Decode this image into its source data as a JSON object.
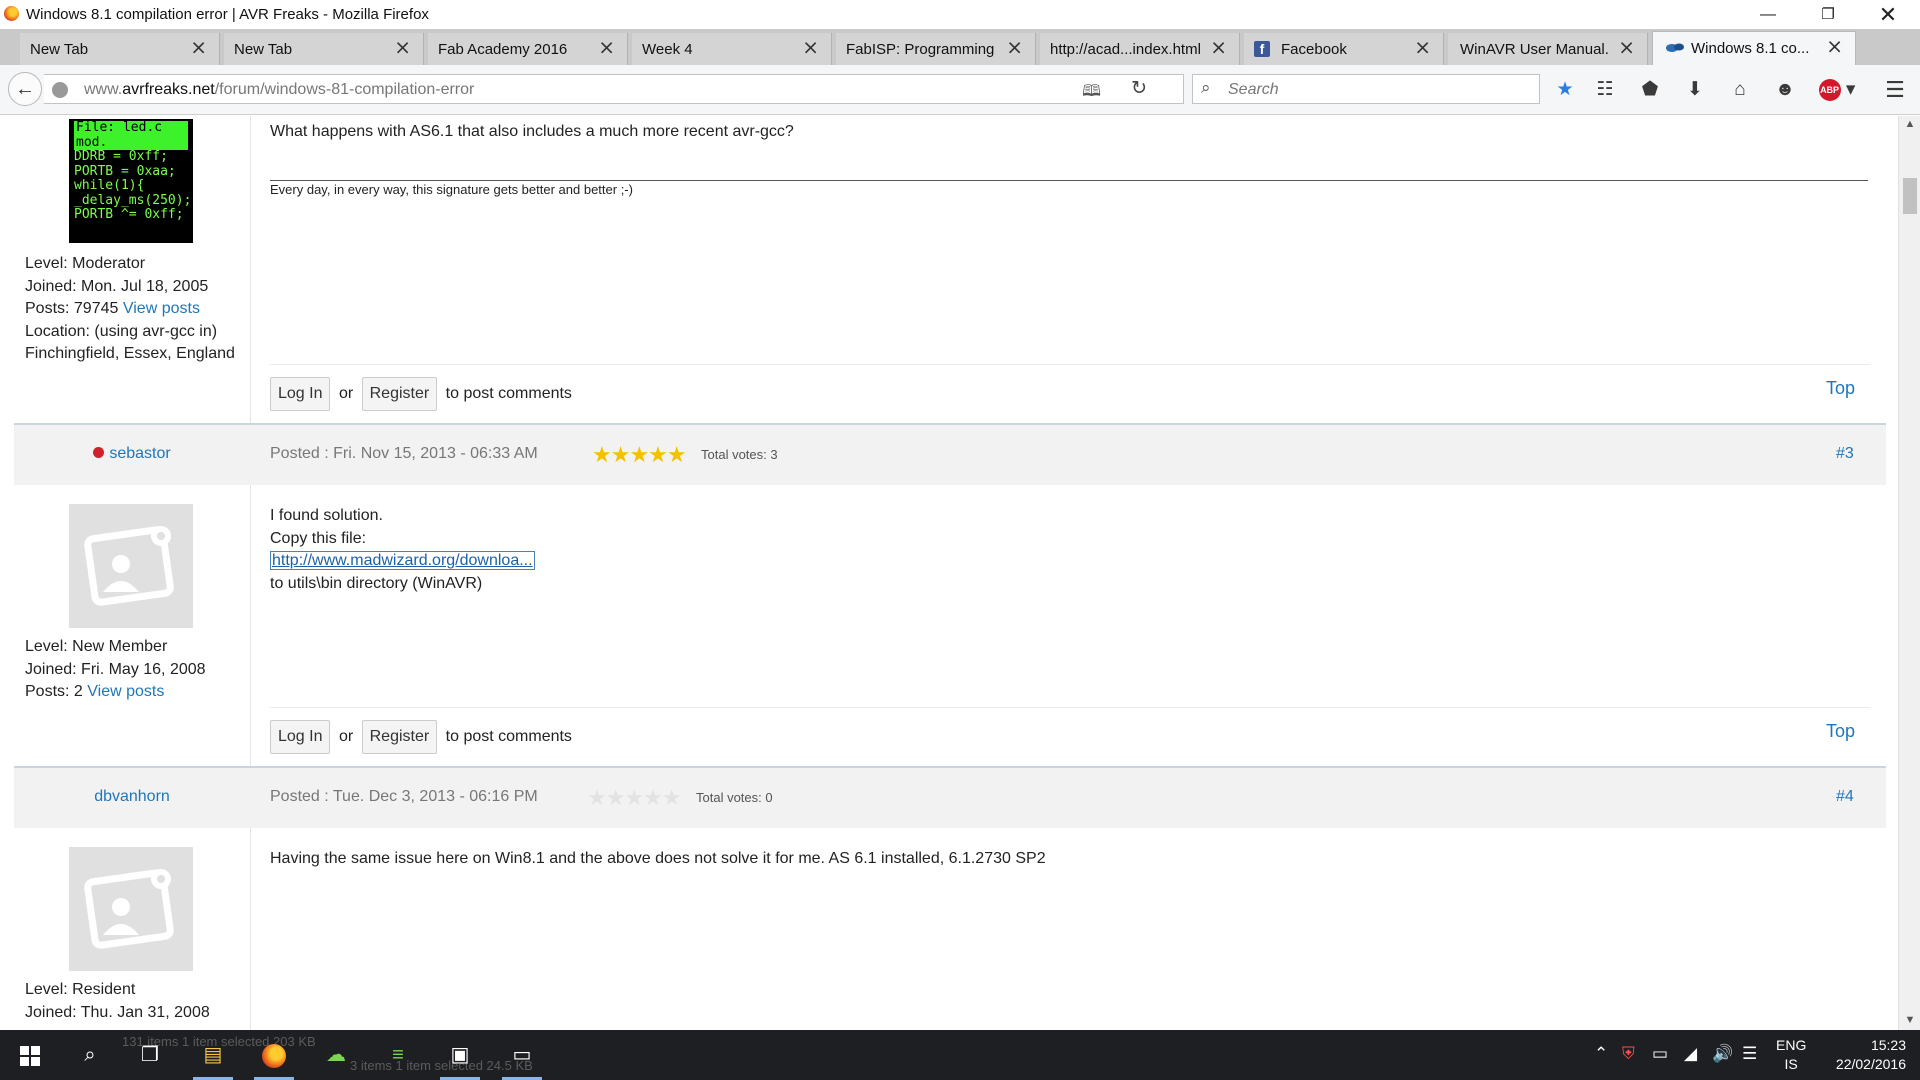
{
  "window": {
    "title": "Windows 8.1 compilation error | AVR Freaks - Mozilla Firefox"
  },
  "tabs": [
    {
      "label": "New Tab"
    },
    {
      "label": "New Tab"
    },
    {
      "label": "Fab Academy 2016"
    },
    {
      "label": "Week 4"
    },
    {
      "label": "FabISP: Programming"
    },
    {
      "label": "http://acad...index.html"
    },
    {
      "label": "Facebook"
    },
    {
      "label": "WinAVR User Manual..."
    },
    {
      "label": "Windows 8.1 co..."
    }
  ],
  "nav": {
    "url_prefix": "www.",
    "url_domain": "avrfreaks.net",
    "url_path": "/forum/windows-81-compilation-error",
    "search_placeholder": "Search",
    "abp_label": "ABP"
  },
  "posts": [
    {
      "avatar_code": [
        "File: led.c  mod.",
        "DDRB = 0xff;",
        "PORTB = 0xaa;",
        "while(1){",
        "  _delay_ms(250);",
        "  PORTB ^= 0xff;"
      ],
      "level": "Level: Moderator",
      "joined": "Joined: Mon. Jul 18, 2005",
      "posts_prefix": "Posts: 79745",
      "view_posts": "View posts",
      "location_1": "Location: (using avr-gcc in)",
      "location_2": "Finchingfield, Essex, England",
      "body_line": "What happens with AS6.1 that also includes a much more recent avr-gcc?",
      "signature": "Every day, in every way, this signature gets better and better ;-)",
      "login": "Log In",
      "or": "or",
      "register": "Register",
      "to_post": "to post comments",
      "top": "Top"
    },
    {
      "user": "sebastor",
      "posted": "Posted : Fri. Nov 15, 2013 - 06:33 AM",
      "stars_filled": 5,
      "total_votes": "Total votes: 3",
      "num": "#3",
      "level": "Level: New Member",
      "joined": "Joined: Fri. May 16, 2008",
      "posts_prefix": "Posts: 2",
      "view_posts": "View posts",
      "body_1": "I found solution.",
      "body_2": "Copy this file:",
      "link": "http://www.madwizard.org/downloa...",
      "body_3": "to utils\\bin directory (WinAVR)",
      "login": "Log In",
      "or": "or",
      "register": "Register",
      "to_post": "to post comments",
      "top": "Top"
    },
    {
      "user": "dbvanhorn",
      "posted": "Posted : Tue. Dec 3, 2013 - 06:16 PM",
      "stars_filled": 0,
      "total_votes": "Total votes: 0",
      "num": "#4",
      "level": "Level: Resident",
      "joined": "Joined: Thu. Jan 31, 2008",
      "body_1": "Having the same issue here on Win8.1 and the above does not solve it for me.  AS 6.1 installed, 6.1.2730 SP2"
    }
  ],
  "taskbar": {
    "ghost_1": "131 items     1 item selected  203 KB",
    "ghost_2": "3 items     1 item selected  24.5 KB",
    "lang_1": "ENG",
    "lang_2": "IS",
    "time": "15:23",
    "date": "22/02/2016"
  },
  "colors": {
    "link": "#1f77b9",
    "star": "#f2c200",
    "offline_dot": "#d0202b"
  }
}
